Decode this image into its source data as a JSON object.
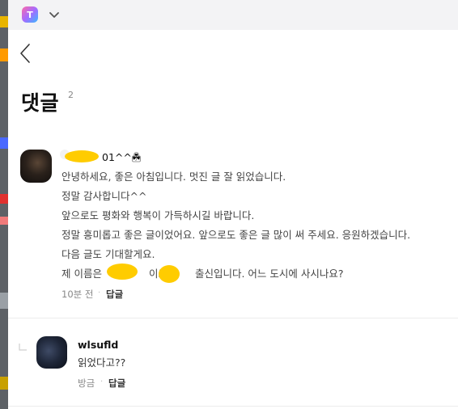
{
  "page": {
    "title": "댓글",
    "comment_count": "2"
  },
  "comments": [
    {
      "author_suffix": "01^^☘",
      "lines": [
        "안녕하세요, 좋은 아침입니다. 멋진 글 잘 읽었습니다.",
        "정말 감사합니다^^",
        "앞으로도 평화와 행복이 가득하시길 바랍니다.",
        "정말 흥미롭고 좋은 글이었어요. 앞으로도 좋은 글 많이 써 주세요. 응원하겠습니다.",
        "다음 글도 기대할게요."
      ],
      "last_line": {
        "part1": "제 이름은",
        "part2": "이고,",
        "part3": "출신입니다. 어느 도시에 사시나요?"
      },
      "time": "10분 전",
      "reply_label": "답글"
    }
  ],
  "reply": {
    "author": "wlsufld",
    "text": "읽었다고??",
    "time": "방금",
    "reply_label": "답글"
  },
  "icons": {
    "app": "app-logo-icon",
    "chevron": "chevron-down-icon",
    "back": "back-arrow-icon",
    "lock": "lock-icon",
    "reply_indicator": "reply-corner-icon"
  },
  "colors": {
    "redaction": "#ffcc00",
    "topbar": "#f3f3f5"
  }
}
